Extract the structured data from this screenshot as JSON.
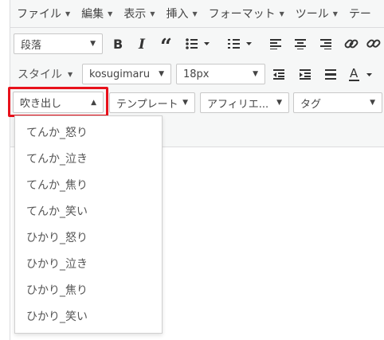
{
  "menubar": {
    "items": [
      {
        "label": "ファイル"
      },
      {
        "label": "編集"
      },
      {
        "label": "表示"
      },
      {
        "label": "挿入"
      },
      {
        "label": "フォーマット"
      },
      {
        "label": "ツール"
      },
      {
        "label": "テー"
      }
    ]
  },
  "toolbar": {
    "paragraph_select": "段落",
    "style_label": "スタイル",
    "font_select": "kosugimaru",
    "size_select": "18px",
    "balloon_select": "吹き出し",
    "template_select": "テンプレート",
    "affiliate_select": "アフィリエ...",
    "tag_select": "タグ"
  },
  "dropdown": {
    "items": [
      {
        "label": "てんか_怒り"
      },
      {
        "label": "てんか_泣き"
      },
      {
        "label": "てんか_焦り"
      },
      {
        "label": "てんか_笑い"
      },
      {
        "label": "ひかり_怒り"
      },
      {
        "label": "ひかり_泣き"
      },
      {
        "label": "ひかり_焦り"
      },
      {
        "label": "ひかり_笑い"
      }
    ]
  },
  "colors": {
    "highlight": "#e8111b",
    "toolbar_bg": "#f6f7f7",
    "border": "#dcdcde"
  }
}
